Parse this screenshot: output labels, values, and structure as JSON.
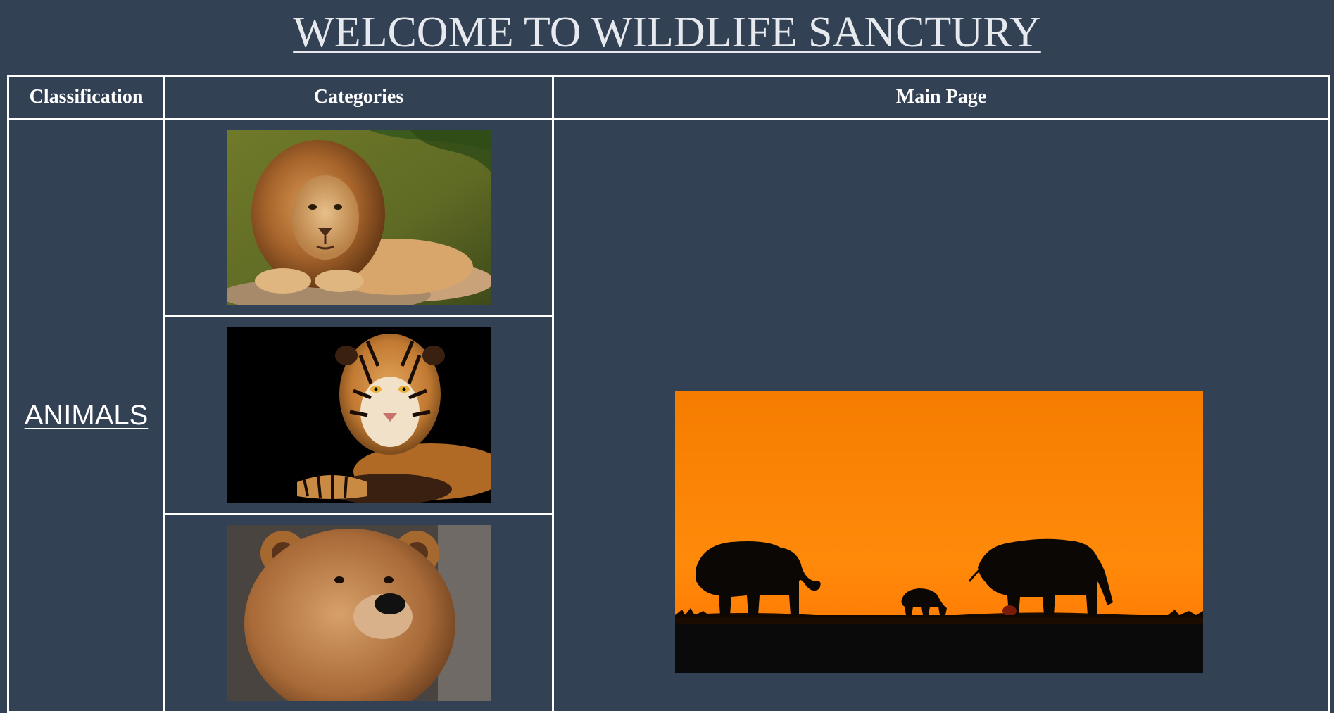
{
  "header": {
    "title": "WELCOME TO WILDLIFE SANCTURY"
  },
  "table": {
    "headers": {
      "classification": "Classification",
      "categories": "Categories",
      "main": "Main Page"
    },
    "classification_link": "ANIMALS",
    "categories": [
      {
        "icon": "lion-photo"
      },
      {
        "icon": "tiger-photo"
      },
      {
        "icon": "bear-photo"
      }
    ],
    "main_image": {
      "icon": "elephants-sunset-photo"
    }
  },
  "colors": {
    "background": "#334155",
    "border": "#ffffff",
    "sunset_orange": "#f57c00"
  }
}
